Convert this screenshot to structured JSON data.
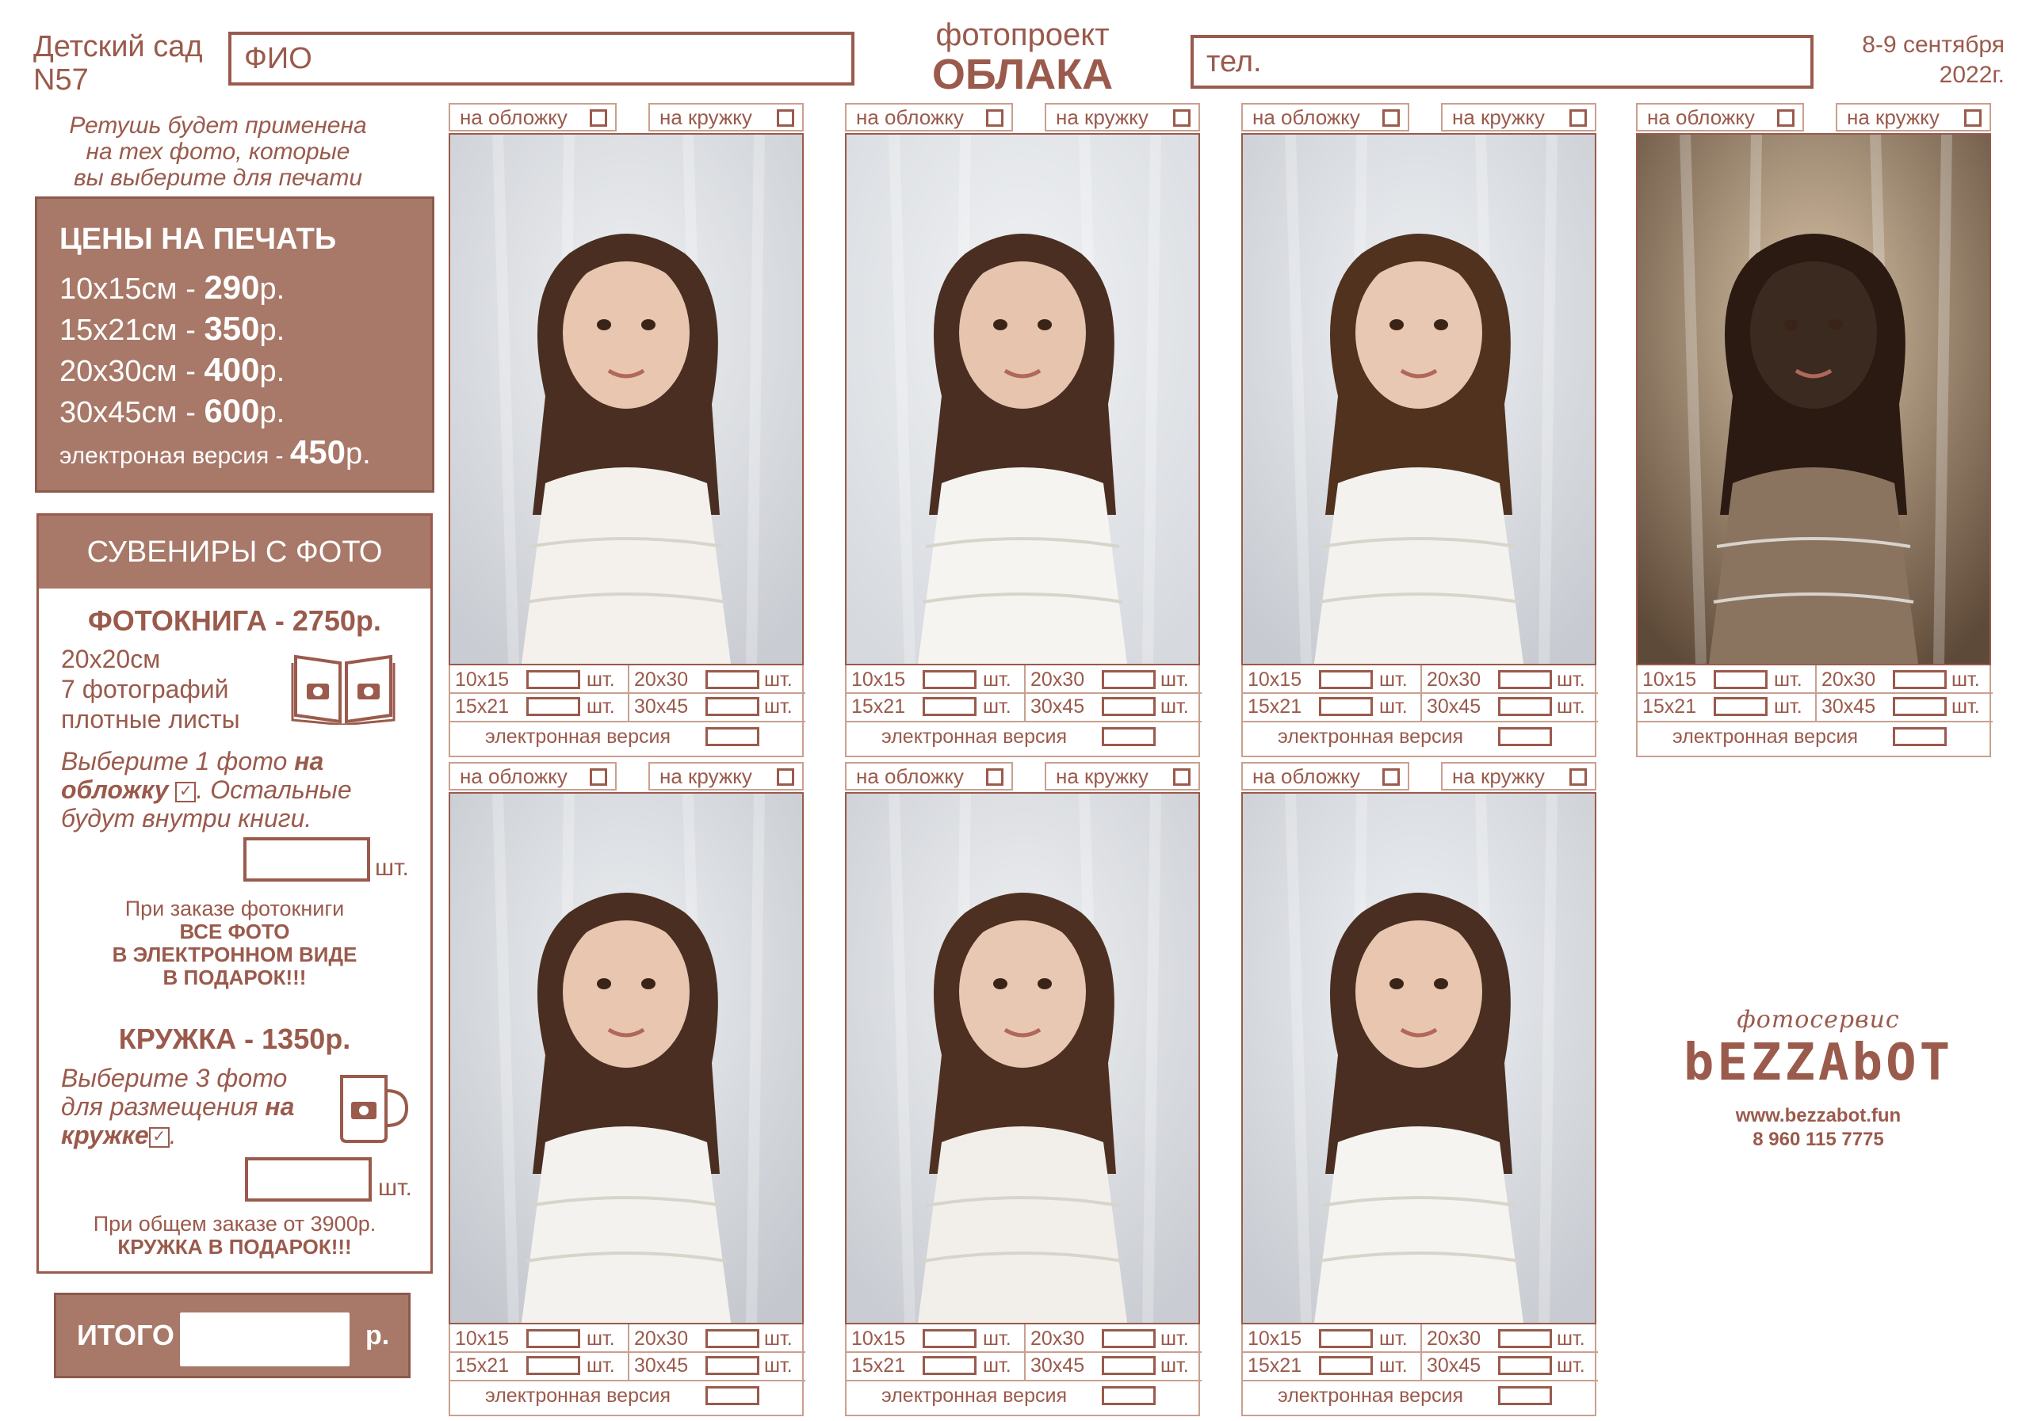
{
  "header": {
    "kindergarten": "Детский сад",
    "kindergarten_no": "N57",
    "name_placeholder": "ФИО",
    "project_line1": "фотопроект",
    "project_line2": "ОБЛАКА",
    "phone_placeholder": "тел.",
    "date_line1": "8-9 сентября",
    "date_line2": "2022г."
  },
  "retouch_note": [
    "Ретушь будет применена",
    "на тех фото, которые",
    "вы выберите для печати"
  ],
  "prices": {
    "title": "ЦЕНЫ НА ПЕЧАТЬ",
    "rows": [
      {
        "size": "10x15см - ",
        "price": "290",
        "unit": "р."
      },
      {
        "size": "15x21см - ",
        "price": "350",
        "unit": "р."
      },
      {
        "size": "20x30см - ",
        "price": "400",
        "unit": "р."
      },
      {
        "size": "30x45см - ",
        "price": "600",
        "unit": "р."
      }
    ],
    "electronic": {
      "label": "электроная версия - ",
      "price": "450",
      "unit": "р."
    }
  },
  "souvenirs": {
    "title": "СУВЕНИРЫ С ФОТО",
    "photobook": {
      "title": "ФОТОКНИГА - 2750р.",
      "spec1": "20x20см",
      "spec2": "7 фотографий",
      "spec3": "плотные листы",
      "note_a": "Выберите 1 фото ",
      "note_b": "на",
      "note_c": "обложку",
      "note_d": ". Остальные",
      "note_e": "будут внутри книги.",
      "qty_unit": "шт.",
      "gift_line1": "При заказе фотокниги",
      "gift_line2": "ВСЕ ФОТО",
      "gift_line3": "В ЭЛЕКТРОННОМ ВИДЕ",
      "gift_line4": "В ПОДАРОК!!!"
    },
    "mug": {
      "title": "КРУЖКА - 1350р.",
      "note_a": "Выберите 3 фото",
      "note_b": "для размещения ",
      "note_c": "на",
      "note_d": "кружке",
      "note_e": ".",
      "qty_unit": "шт.",
      "gift_line1": "При общем заказе от 3900р.",
      "gift_line2": "КРУЖКА В ПОДАРОК!!!"
    }
  },
  "total": {
    "label": "ИТОГО",
    "unit": "р."
  },
  "photo_card": {
    "cover": "на обложку",
    "mug": "на кружку",
    "s1": "10x15",
    "s2": "20x30",
    "s3": "15x21",
    "s4": "30x45",
    "unit": "шт.",
    "electronic": "электронная версия"
  },
  "logo": {
    "small": "фотосервис",
    "big": "bEZZAbOT"
  },
  "contact": {
    "site": "www.bezzabot.fun",
    "phone": "8 960 115 7775"
  },
  "colors": {
    "accent": "#9a5a4c",
    "panel": "#a87868"
  }
}
